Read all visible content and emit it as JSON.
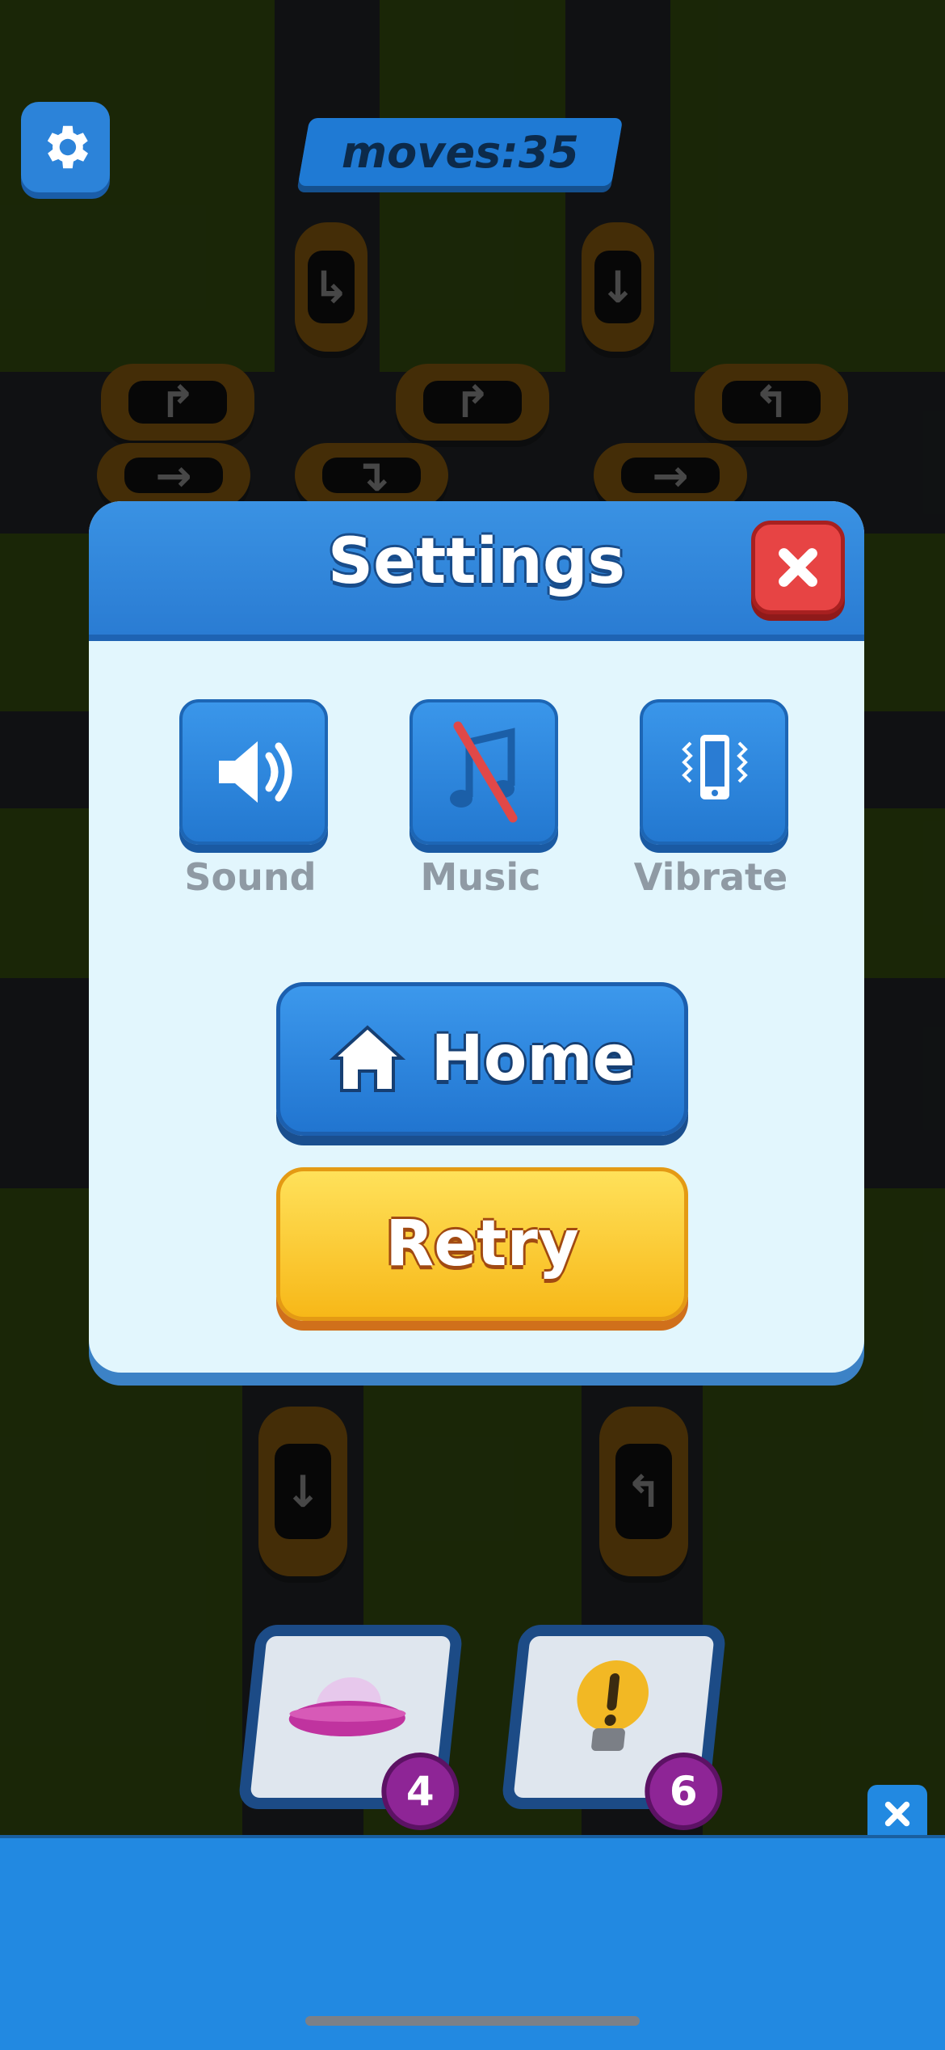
{
  "hud": {
    "moves_text": "moves:35"
  },
  "dialog": {
    "title": "Settings",
    "options": [
      {
        "label": "Sound",
        "icon": "speaker-icon"
      },
      {
        "label": "Music",
        "icon": "music-note-muted-icon"
      },
      {
        "label": "Vibrate",
        "icon": "vibrate-phone-icon"
      }
    ],
    "home_label": "Home",
    "retry_label": "Retry"
  },
  "boosters": [
    {
      "icon": "ufo-icon",
      "count": "4"
    },
    {
      "icon": "lightbulb-hint-icon",
      "count": "6"
    }
  ],
  "colors": {
    "panel_blue": "#2a7cd3",
    "close_red": "#e74444",
    "retry_yellow": "#f7b818",
    "panel_bg": "#e2f6fd",
    "car_orange": "#f5a21b"
  }
}
